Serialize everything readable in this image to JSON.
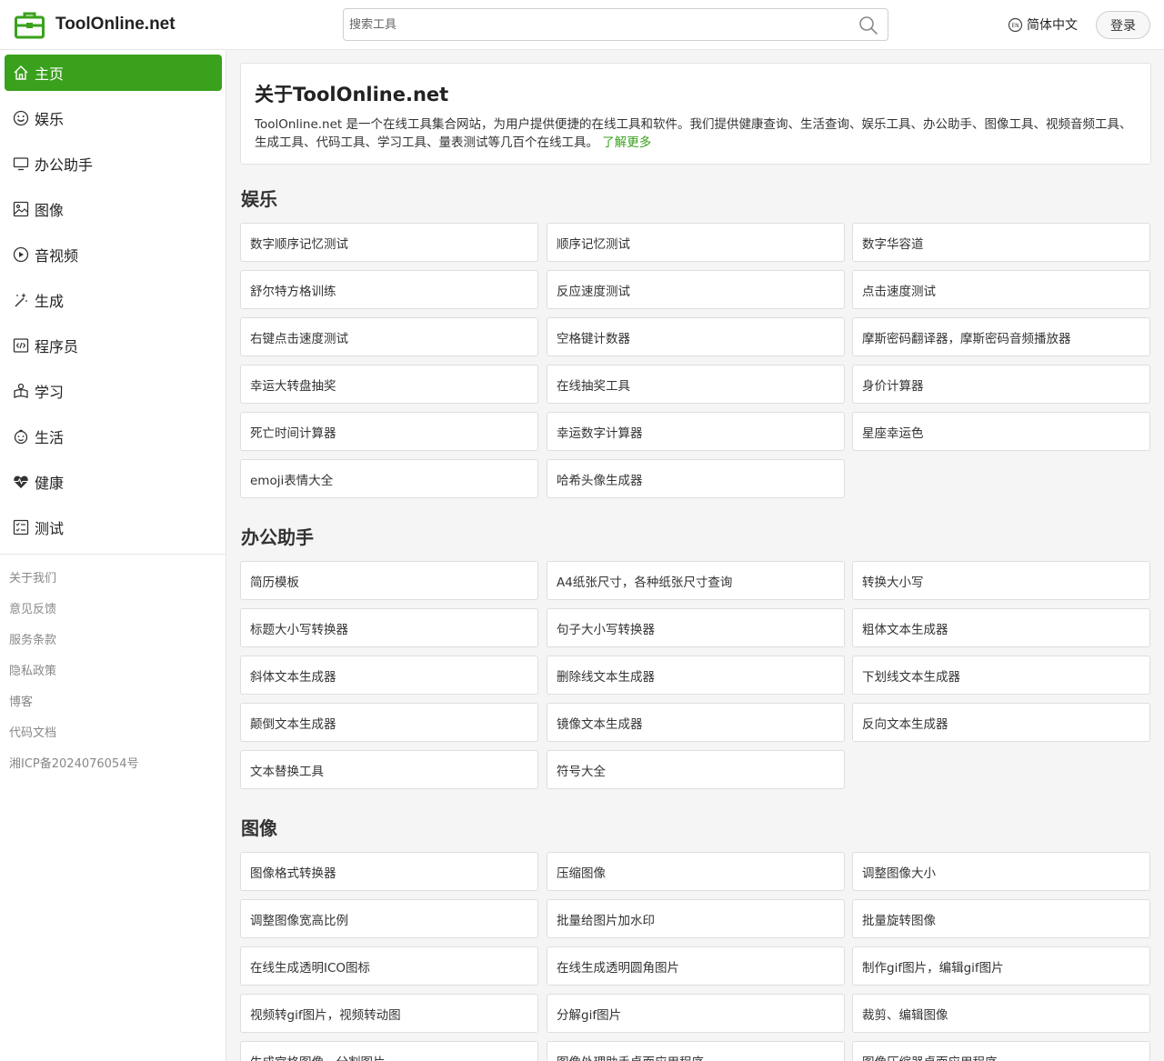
{
  "header": {
    "logo_text": "ToolOnline.net",
    "search_placeholder": "搜索工具",
    "lang_label": "简体中文",
    "login_label": "登录"
  },
  "sidebar": {
    "nav": [
      {
        "label": "主页",
        "icon": "home-icon"
      },
      {
        "label": "娱乐",
        "icon": "smile-icon"
      },
      {
        "label": "办公助手",
        "icon": "monitor-icon"
      },
      {
        "label": "图像",
        "icon": "image-icon"
      },
      {
        "label": "音视频",
        "icon": "video-icon"
      },
      {
        "label": "生成",
        "icon": "magic-wand-icon"
      },
      {
        "label": "程序员",
        "icon": "code-icon"
      },
      {
        "label": "学习",
        "icon": "learning-icon"
      },
      {
        "label": "生活",
        "icon": "life-icon"
      },
      {
        "label": "健康",
        "icon": "heart-pulse-icon"
      },
      {
        "label": "测试",
        "icon": "checklist-icon"
      }
    ],
    "footer_links": [
      "关于我们",
      "意见反馈",
      "服务条款",
      "隐私政策",
      "博客",
      "代码文档",
      "湘ICP备2024076054号"
    ]
  },
  "about": {
    "title": "关于ToolOnline.net",
    "text": "ToolOnline.net 是一个在线工具集合网站，为用户提供便捷的在线工具和软件。我们提供健康查询、生活查询、娱乐工具、办公助手、图像工具、视频音频工具、生成工具、代码工具、学习工具、量表测试等几百个在线工具。",
    "more_link": "了解更多"
  },
  "sections": [
    {
      "title": "娱乐",
      "tools": [
        "数字顺序记忆测试",
        "顺序记忆测试",
        "数字华容道",
        "舒尔特方格训练",
        "反应速度测试",
        "点击速度测试",
        "右键点击速度测试",
        "空格键计数器",
        "摩斯密码翻译器，摩斯密码音频播放器",
        "幸运大转盘抽奖",
        "在线抽奖工具",
        "身价计算器",
        "死亡时间计算器",
        "幸运数字计算器",
        "星座幸运色",
        "emoji表情大全",
        "哈希头像生成器"
      ]
    },
    {
      "title": "办公助手",
      "tools": [
        "简历模板",
        "A4纸张尺寸，各种纸张尺寸查询",
        "转换大小写",
        "标题大小写转换器",
        "句子大小写转换器",
        "粗体文本生成器",
        "斜体文本生成器",
        "删除线文本生成器",
        "下划线文本生成器",
        "颠倒文本生成器",
        "镜像文本生成器",
        "反向文本生成器",
        "文本替换工具",
        "符号大全"
      ]
    },
    {
      "title": "图像",
      "tools": [
        "图像格式转换器",
        "压缩图像",
        "调整图像大小",
        "调整图像宽高比例",
        "批量给图片加水印",
        "批量旋转图像",
        "在线生成透明ICO图标",
        "在线生成透明圆角图片",
        "制作gif图片，编辑gif图片",
        "视频转gif图片，视频转动图",
        "分解gif图片",
        "裁剪、编辑图像",
        "生成宫格图像，分割图片",
        "图像处理助手桌面应用程序",
        "图像压缩器桌面应用程序"
      ]
    }
  ]
}
